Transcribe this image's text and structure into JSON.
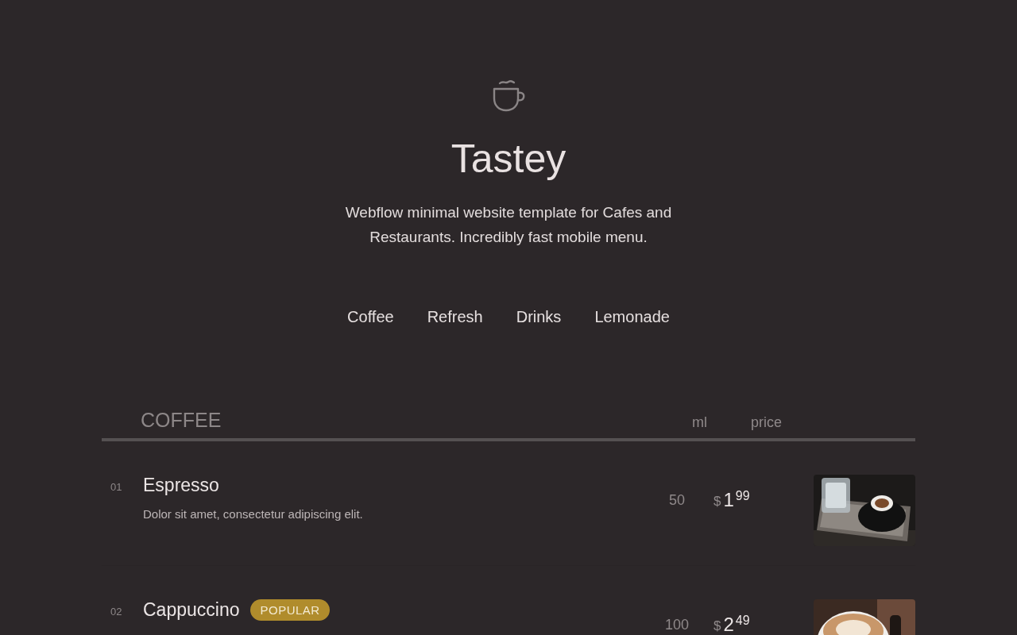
{
  "hero": {
    "title": "Tastey",
    "subtitle": "Webflow minimal website template for Cafes and Restaurants. Incredibly fast mobile menu."
  },
  "tabs": [
    {
      "label": "Coffee"
    },
    {
      "label": "Refresh"
    },
    {
      "label": "Drinks"
    },
    {
      "label": "Lemonade"
    }
  ],
  "menu": {
    "section": "COFFEE",
    "columns": [
      "ml",
      "price"
    ],
    "items": [
      {
        "number": "01",
        "name": "Espresso",
        "description": "Dolor sit amet, consectetur adipiscing elit.",
        "ml": "50",
        "currency": "$",
        "price_whole": "1",
        "price_cents": "99"
      },
      {
        "number": "02",
        "name": "Cappuccino",
        "badge": "POPULAR",
        "ml": "100",
        "currency": "$",
        "price_whole": "2",
        "price_cents": "49"
      }
    ]
  }
}
